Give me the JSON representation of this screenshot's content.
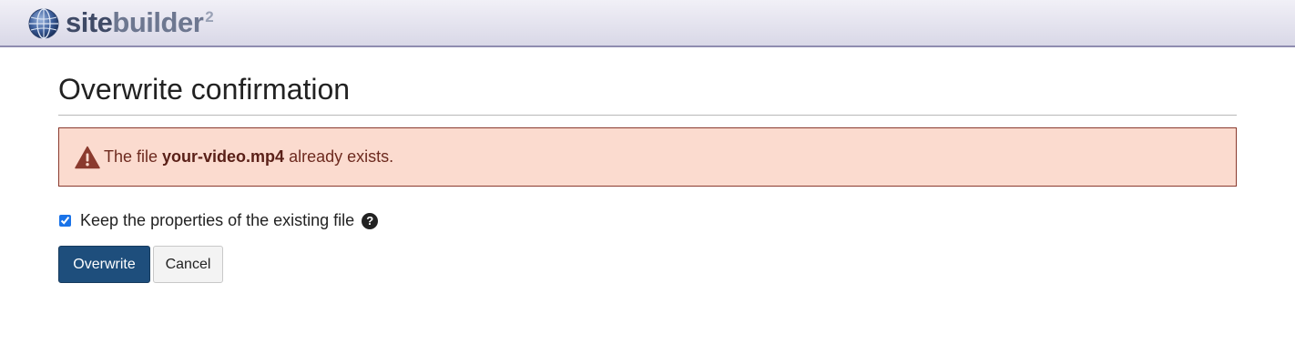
{
  "header": {
    "logo_site": "site",
    "logo_builder": "builder",
    "logo_version": "2",
    "icon": "globe-icon"
  },
  "page": {
    "title": "Overwrite confirmation"
  },
  "alert": {
    "icon": "warning-icon",
    "prefix": "The file ",
    "filename": "your-video.mp4",
    "suffix": " already exists.",
    "background": "#fbdbcf",
    "border": "#8a3a2e"
  },
  "options": {
    "keep_properties_label": "Keep the properties of the existing file",
    "keep_properties_checked": true,
    "help_icon": "question-circle-icon"
  },
  "buttons": {
    "overwrite_label": "Overwrite",
    "cancel_label": "Cancel",
    "primary_color": "#1e4e7c"
  }
}
